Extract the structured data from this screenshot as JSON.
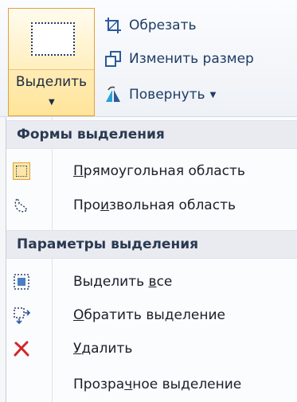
{
  "ribbon": {
    "select_button_label": "Выделить",
    "crop_label": "Обрезать",
    "resize_label": "Изменить размер",
    "rotate_label": "Повернуть"
  },
  "menu": {
    "shapes_header": "Формы выделения",
    "rect_pre": "",
    "rect_u": "П",
    "rect_post": "рямоугольная область",
    "free_pre": "Про",
    "free_u": "и",
    "free_post": "звольная область",
    "options_header": "Параметры выделения",
    "selall_pre": "Выделить ",
    "selall_u": "в",
    "selall_post": "се",
    "invert_pre": "",
    "invert_u": "О",
    "invert_post": "братить выделение",
    "delete_pre": "",
    "delete_u": "У",
    "delete_post": "далить",
    "transp_pre": "Прозра",
    "transp_u": "ч",
    "transp_post": "ное выделение"
  },
  "colors": {
    "highlight": "#ffe49a",
    "accent_blue": "#1f3c66",
    "delete_red": "#d4262b"
  },
  "icons": [
    "select-rect-icon",
    "crop-icon",
    "resize-icon",
    "rotate-icon",
    "rect-select-icon",
    "free-select-icon",
    "select-all-icon",
    "invert-select-icon",
    "delete-icon",
    "dropdown-arrow-icon"
  ]
}
